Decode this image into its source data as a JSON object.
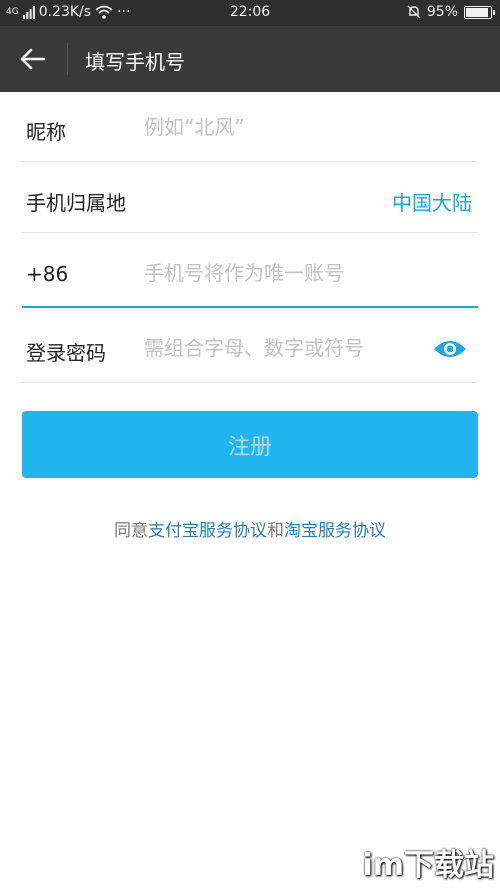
{
  "status_bar": {
    "network": "4G",
    "speed": "0.23K/s",
    "more": "···",
    "time": "22:06",
    "battery": "95%",
    "battery_level": 0.95
  },
  "app_bar": {
    "title": "填写手机号"
  },
  "form": {
    "nickname": {
      "label": "昵称",
      "placeholder": "例如“北风”"
    },
    "region": {
      "label": "手机归属地",
      "value": "中国大陆"
    },
    "phone": {
      "prefix": "+86",
      "placeholder": "手机号将作为唯一账号"
    },
    "password": {
      "label": "登录密码",
      "placeholder": "需组合字母、数字或符号"
    }
  },
  "register_button": {
    "label": "注册"
  },
  "agreement": {
    "prefix": "同意",
    "link1": "支付宝服务协议",
    "connector": "和",
    "link2": "淘宝服务协议"
  },
  "watermark": {
    "text": "im下载站"
  },
  "colors": {
    "accent": "#21b4ef",
    "link": "#1aa6d6",
    "app_bar": "#3a3a3a"
  }
}
